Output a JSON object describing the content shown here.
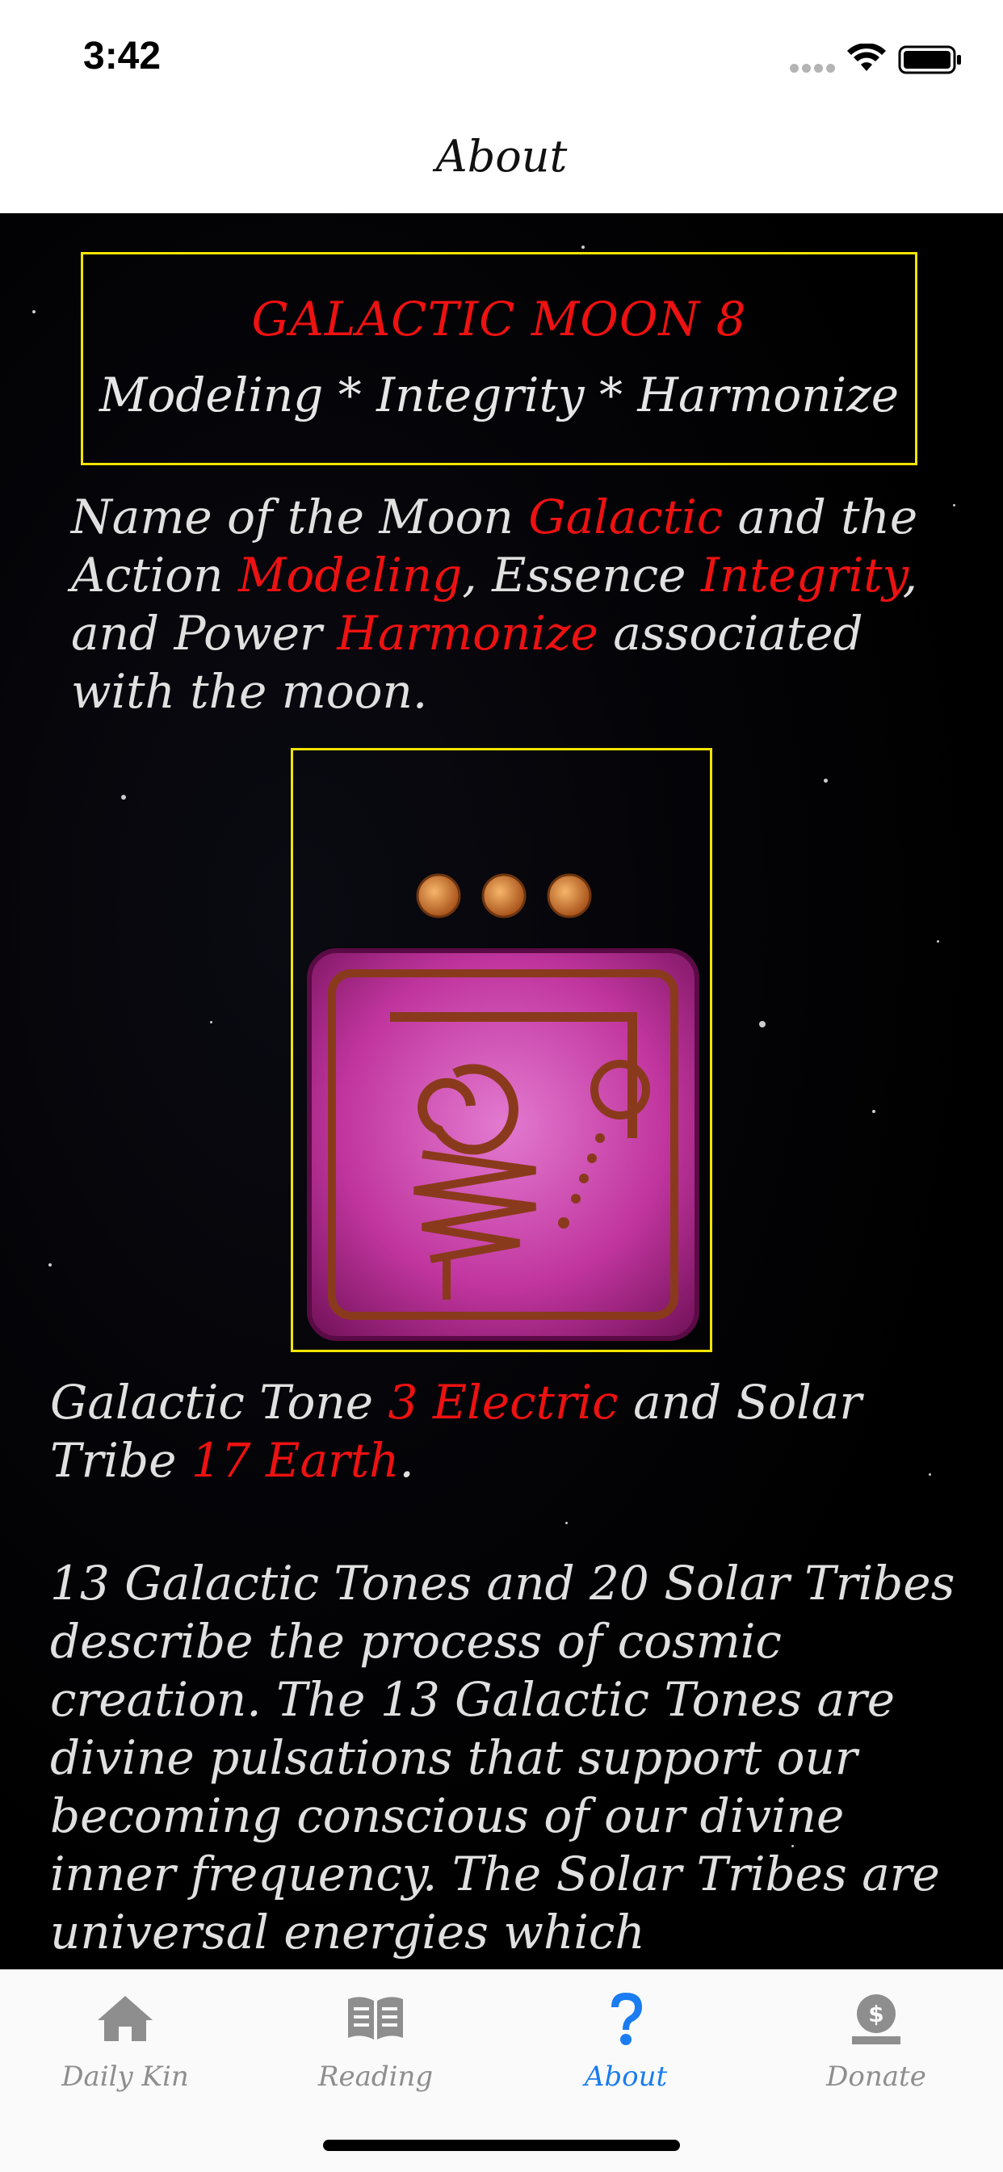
{
  "status_bar": {
    "time": "3:42"
  },
  "nav": {
    "title": "About"
  },
  "moon_box": {
    "title": "GALACTIC MOON 8",
    "subtitle": "Modeling * Integrity * Harmonize"
  },
  "moon_paragraph": {
    "t1": "Name of the Moon ",
    "moon": "Galactic",
    "t2": " and the Action ",
    "action": "Modeling",
    "t3": ", Essence ",
    "essence": "Integrity",
    "t4": ", and Power ",
    "power": "Harmonize",
    "t5": " associated with the moon."
  },
  "tone_paragraph": {
    "t1": "Galactic Tone ",
    "tone": "3 Electric",
    "t2": " and Solar Tribe ",
    "tribe": "17 Earth",
    "t3": "."
  },
  "description": "13 Galactic Tones and 20 Solar Tribes describe the process of cosmic creation.  The 13 Galactic Tones are divine pulsations that support our becoming conscious of our divine inner frequency.  The Solar Tribes are universal energies which",
  "tabs": [
    {
      "label": "Daily Kin",
      "icon": "home-icon",
      "active": false
    },
    {
      "label": "Reading",
      "icon": "book-icon",
      "active": false
    },
    {
      "label": "About",
      "icon": "question-icon",
      "active": true
    },
    {
      "label": "Donate",
      "icon": "donate-icon",
      "active": false
    }
  ],
  "colors": {
    "accent_red": "#ee1111",
    "frame_yellow": "#f2e400",
    "tab_active": "#1a7cf0",
    "tab_inactive": "#8e8e8e"
  }
}
